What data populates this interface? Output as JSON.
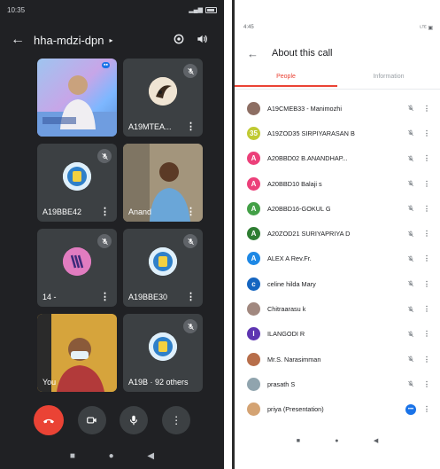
{
  "left": {
    "status": {
      "time": "10:35",
      "icons": "⊙ ··",
      "right": "ᵃᵢ|"
    },
    "meeting_code": "hha-mdzi-dpn",
    "tiles": [
      {
        "name": "",
        "type": "video-person",
        "mic_off": false
      },
      {
        "name": "A19MTEA...",
        "type": "avatar-image",
        "mic_off": true
      },
      {
        "name": "A19BBE42",
        "type": "logo",
        "mic_off": true
      },
      {
        "name": "Anand",
        "type": "video-person",
        "mic_off": false
      },
      {
        "name": "14 -",
        "type": "avatar-letter",
        "mic_off": true
      },
      {
        "name": "A19BBE30",
        "type": "logo",
        "mic_off": true
      },
      {
        "name": "You",
        "type": "video-self",
        "mic_off": false
      },
      {
        "name": "A19B · 92 others",
        "type": "logo",
        "mic_off": true
      }
    ],
    "more_glyph": "⋮"
  },
  "right": {
    "status": {
      "time": "4:45",
      "right": "ᴸᵀᴱ ▣"
    },
    "title": "About this call",
    "tabs": [
      "People",
      "Information"
    ],
    "participants": [
      {
        "name": "A19CMEB33 - Manimozhi",
        "color": "#8d6e63",
        "initial": ""
      },
      {
        "name": "A19ZOD35 SIRPIYARASAN B",
        "color": "#c0ca33",
        "initial": "35"
      },
      {
        "name": "A20BBD02 B.ANANDHAP...",
        "color": "#ec407a",
        "initial": "A"
      },
      {
        "name": "A20BBD10 Balaji s",
        "color": "#ec407a",
        "initial": "A"
      },
      {
        "name": "A20BBD16-GOKUL G",
        "color": "#43a047",
        "initial": "A"
      },
      {
        "name": "A20ZOD21 SURIYAPRIYA D",
        "color": "#2e7d32",
        "initial": "A"
      },
      {
        "name": "ALEX A Rev.Fr.",
        "color": "#1e88e5",
        "initial": "A"
      },
      {
        "name": "celine hilda Mary",
        "color": "#1565c0",
        "initial": "c"
      },
      {
        "name": "Chitraarasu k",
        "color": "#a1887f",
        "initial": ""
      },
      {
        "name": "ILANGODI R",
        "color": "#5e35b1",
        "initial": "I"
      },
      {
        "name": "Mr.S. Narasimman",
        "color": "#b76e4a",
        "initial": ""
      },
      {
        "name": "prasath S",
        "color": "#90a4ae",
        "initial": ""
      },
      {
        "name": "priya (Presentation)",
        "color": "#d4a373",
        "initial": "",
        "presenting": true
      }
    ],
    "more_glyph": "⋮",
    "presenting_glyph": "•••"
  },
  "colors": {
    "accent": "#ea4335",
    "end_call": "#ea4335",
    "dark_bg": "#202124"
  },
  "nav": {
    "square": "■",
    "circle": "●",
    "back": "◀"
  }
}
